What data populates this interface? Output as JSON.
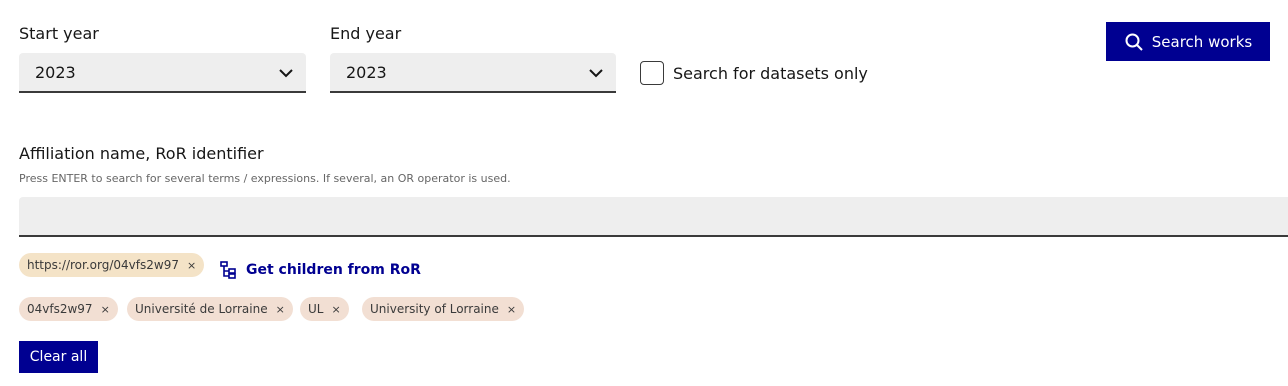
{
  "start_year": {
    "label": "Start year",
    "value": "2023"
  },
  "end_year": {
    "label": "End year",
    "value": "2023"
  },
  "datasets_only": {
    "label": "Search for datasets only",
    "checked": false
  },
  "search_button": {
    "label": "Search works",
    "icon": "search-icon"
  },
  "affiliation": {
    "label": "Affiliation name, RoR identifier",
    "hint": "Press ENTER to search for several terms / expressions. If several, an OR operator is used.",
    "value": "",
    "ror_tags": [
      "https://ror.org/04vfs2w97"
    ],
    "children_link": "Get children from RoR",
    "name_tags": [
      "04vfs2w97",
      "Université de Lorraine",
      "UL",
      "University of Lorraine"
    ],
    "tag_close": "×"
  },
  "clear_button": {
    "label": "Clear all"
  },
  "colors": {
    "primary": "#000091",
    "ror_tag": "#f4e3c7",
    "name_tag": "#f2dfd3",
    "field_bg": "#eeeeee"
  }
}
